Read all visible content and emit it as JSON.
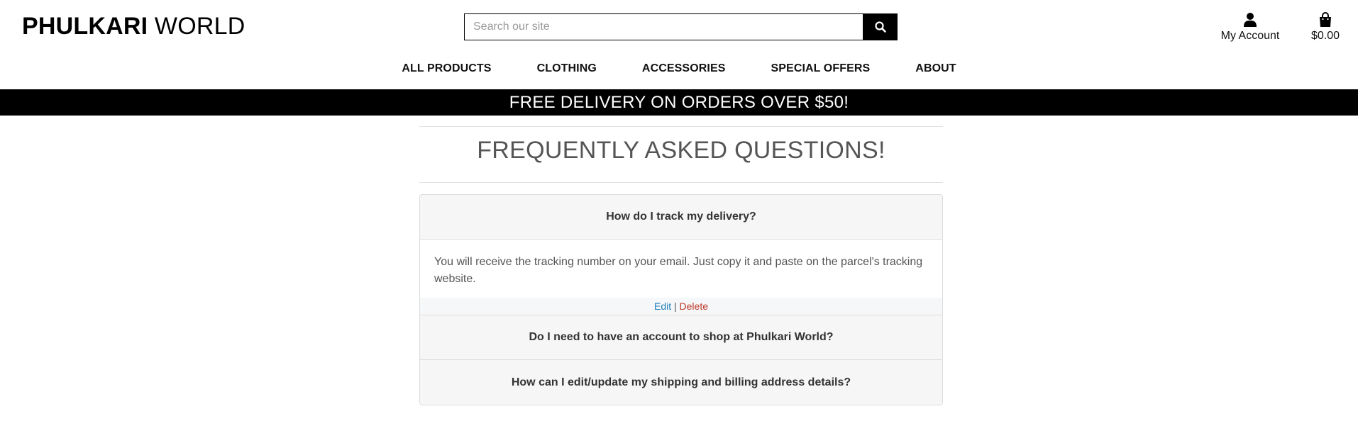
{
  "brand": {
    "bold": "PHULKARI",
    "thin": "WORLD"
  },
  "search": {
    "placeholder": "Search our site",
    "icon": "search-icon"
  },
  "account": {
    "label": "My Account",
    "icon": "user-icon"
  },
  "cart": {
    "total": "$0.00",
    "icon": "shopping-bag-icon"
  },
  "nav": {
    "items": [
      "ALL PRODUCTS",
      "CLOTHING",
      "ACCESSORIES",
      "SPECIAL OFFERS",
      "ABOUT"
    ]
  },
  "banner": {
    "text": "FREE DELIVERY ON ORDERS OVER $50!"
  },
  "page": {
    "title": "FREQUENTLY ASKED QUESTIONS!"
  },
  "faq": {
    "items": [
      {
        "question": "How do I track my delivery?",
        "answer": "You will receive the tracking number on your email. Just copy it and paste on the parcel's tracking website."
      },
      {
        "question": "Do I need to have an account to shop at Phulkari World?"
      },
      {
        "question": "How can I edit/update my shipping and billing address details?"
      }
    ],
    "actions": {
      "edit": "Edit",
      "separator": "|",
      "delete": "Delete"
    }
  },
  "colors": {
    "banner_bg": "#000000",
    "edit_link": "#1f7fbd",
    "delete_link": "#c0392b",
    "question_bg": "#f6f6f6"
  }
}
